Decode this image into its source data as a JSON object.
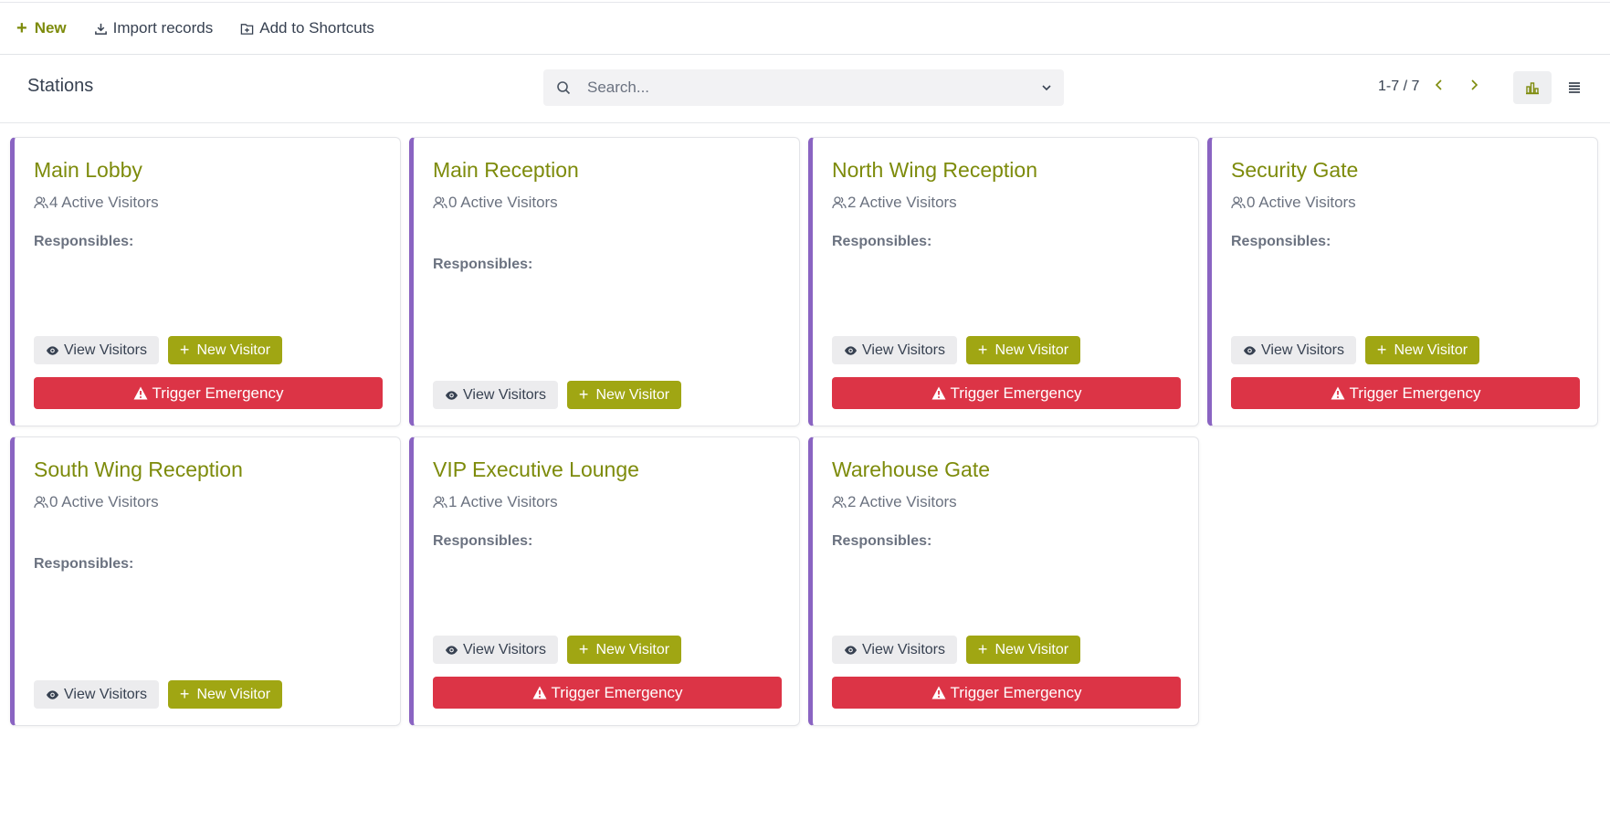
{
  "toolbar": {
    "new_label": "New",
    "import_label": "Import records",
    "shortcuts_label": "Add to Shortcuts"
  },
  "controlbar": {
    "title": "Stations",
    "search_placeholder": "Search...",
    "pager": "1-7 / 7"
  },
  "colors": {
    "accent": "#7d8b0b",
    "new_visitor_button": "#a0a613",
    "emergency": "#dc3446",
    "card_border": "#8a64c2"
  },
  "cards": [
    {
      "name": "Main Lobby",
      "visitors": "4 Active Visitors",
      "responsibles": "Responsibles:",
      "view_label": "View Visitors",
      "new_label": "New Visitor",
      "emergency_label": "Trigger Emergency"
    },
    {
      "name": "Main Reception",
      "visitors": "0 Active Visitors",
      "responsibles": "Responsibles:",
      "view_label": "View Visitors",
      "new_label": "New Visitor"
    },
    {
      "name": "North Wing Reception",
      "visitors": "2 Active Visitors",
      "responsibles": "Responsibles:",
      "view_label": "View Visitors",
      "new_label": "New Visitor",
      "emergency_label": "Trigger Emergency"
    },
    {
      "name": "Security Gate",
      "visitors": "0 Active Visitors",
      "responsibles": "Responsibles:",
      "view_label": "View Visitors",
      "new_label": "New Visitor",
      "emergency_label": "Trigger Emergency"
    },
    {
      "name": "South Wing Reception",
      "visitors": "0 Active Visitors",
      "responsibles": "Responsibles:",
      "view_label": "View Visitors",
      "new_label": "New Visitor"
    },
    {
      "name": "VIP Executive Lounge",
      "visitors": "1 Active Visitors",
      "responsibles": "Responsibles:",
      "view_label": "View Visitors",
      "new_label": "New Visitor",
      "emergency_label": "Trigger Emergency"
    },
    {
      "name": "Warehouse Gate",
      "visitors": "2 Active Visitors",
      "responsibles": "Responsibles:",
      "view_label": "View Visitors",
      "new_label": "New Visitor",
      "emergency_label": "Trigger Emergency"
    }
  ]
}
